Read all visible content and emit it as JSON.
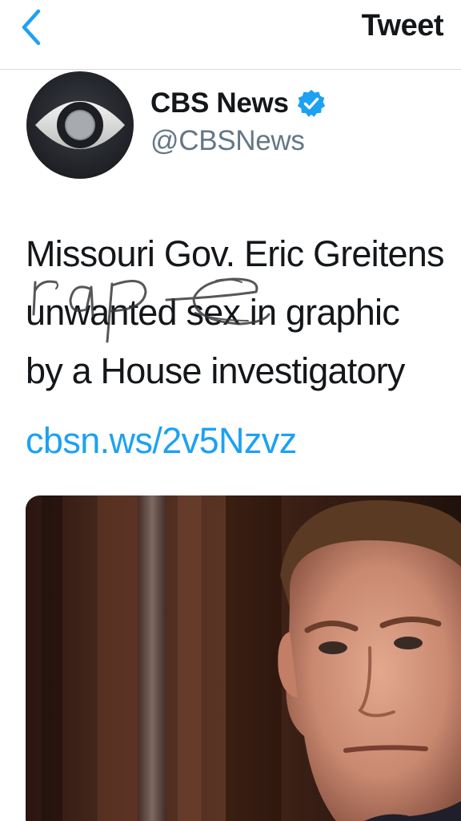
{
  "nav": {
    "back_icon": "chevron-left-icon",
    "title": "Tweet",
    "accent_color": "#1da1f2"
  },
  "author": {
    "name": "CBS News",
    "handle": "@CBSNews",
    "verified": true,
    "avatar_icon": "cbs-eye-logo"
  },
  "tweet": {
    "lines": [
      "Missouri Gov. Eric Greitens",
      "unwanted sex in graphic",
      "by a House investigatory"
    ],
    "link": "cbsn.ws/2v5Nzvz",
    "handwritten_overlay": "rape",
    "media_description_icon": "photo"
  },
  "colors": {
    "text": "#14171a",
    "secondary": "#657786",
    "link": "#1da1f2",
    "border": "#d9d9d9"
  }
}
